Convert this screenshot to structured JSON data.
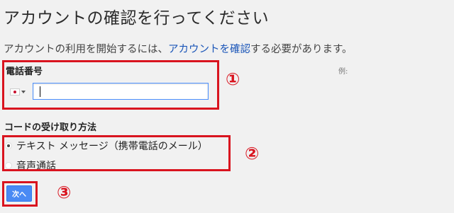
{
  "title": "アカウントの確認を行ってください",
  "description": {
    "prefix": "アカウントの利用を開始するには、",
    "link": "アカウントを確認",
    "suffix": "する必要があります。"
  },
  "phone": {
    "label": "電話番号",
    "example": "例:",
    "country_icon": "japan-flag-icon",
    "value": ""
  },
  "method": {
    "label": "コードの受け取り方法",
    "options": [
      {
        "label": "テキスト メッセージ（携帯電話のメール）",
        "checked": true
      },
      {
        "label": "音声通話",
        "checked": false
      }
    ]
  },
  "next_button": "次へ",
  "annotations": [
    "①",
    "②",
    "③"
  ],
  "colors": {
    "highlight": "#d9141f",
    "link": "#1a55b8",
    "button": "#4a8af4"
  }
}
